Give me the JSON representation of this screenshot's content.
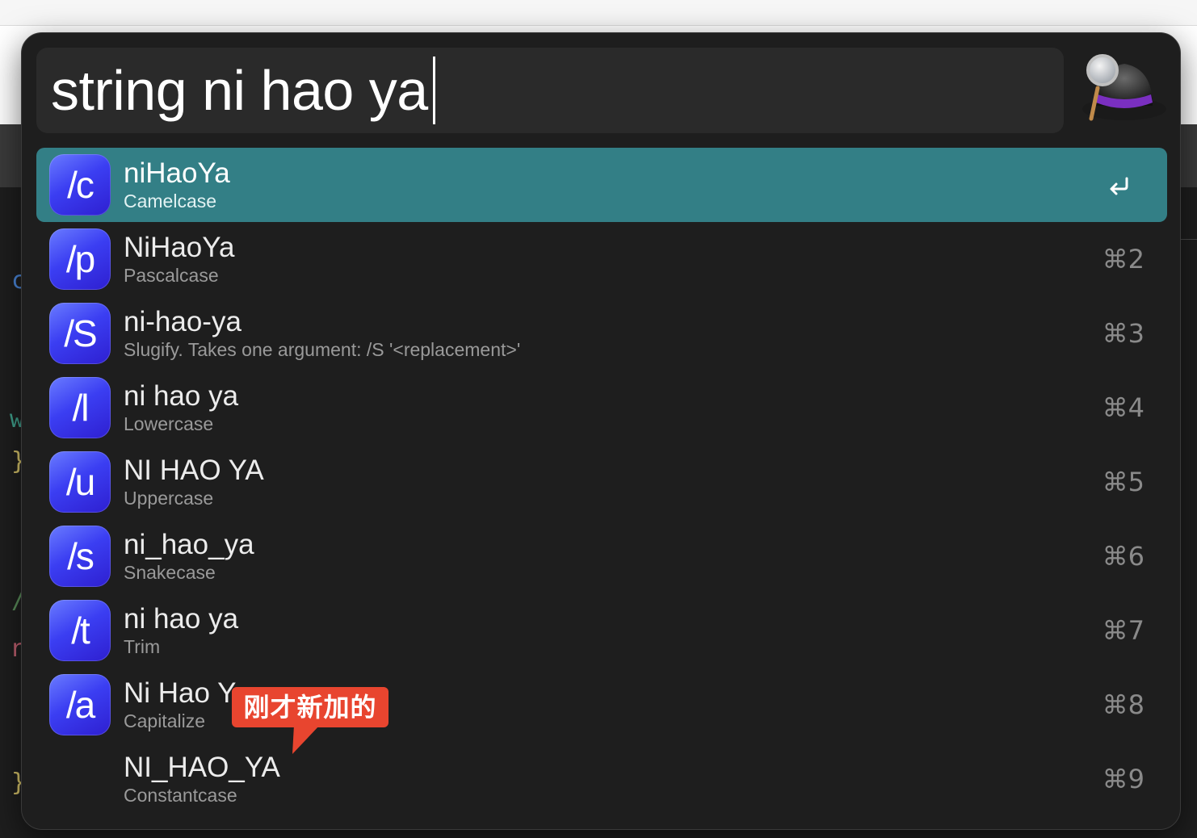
{
  "search": {
    "query": "string ni hao ya"
  },
  "results": [
    {
      "icon_text": "/c",
      "title": "niHaoYa",
      "subtitle": "Camelcase",
      "shortcut": "",
      "selected": true
    },
    {
      "icon_text": "/p",
      "title": "NiHaoYa",
      "subtitle": "Pascalcase",
      "shortcut": "⌘2"
    },
    {
      "icon_text": "/S",
      "title": "ni-hao-ya",
      "subtitle": "Slugify. Takes one argument:  /S '<replacement>'",
      "shortcut": "⌘3"
    },
    {
      "icon_text": "/l",
      "title": "ni hao ya",
      "subtitle": "Lowercase",
      "shortcut": "⌘4"
    },
    {
      "icon_text": "/u",
      "title": "NI HAO YA",
      "subtitle": "Uppercase",
      "shortcut": "⌘5"
    },
    {
      "icon_text": "/s",
      "title": "ni_hao_ya",
      "subtitle": "Snakecase",
      "shortcut": "⌘6"
    },
    {
      "icon_text": "/t",
      "title": "ni hao ya",
      "subtitle": "Trim",
      "shortcut": "⌘7"
    },
    {
      "icon_text": "/a",
      "title": "Ni Hao Y",
      "subtitle": "Capitalize",
      "shortcut": "⌘8"
    },
    {
      "icon_text": "",
      "title": "NI_HAO_YA",
      "subtitle": "Constantcase",
      "shortcut": "⌘9"
    }
  ],
  "annotation": {
    "text": "刚才新加的"
  },
  "icons": {
    "enter": "return-icon",
    "logo": "alfred-hat-icon"
  },
  "colors": {
    "selected_row": "#337f86",
    "callout": "#e8452f",
    "icon_gradient_start": "#6a7cff",
    "icon_gradient_end": "#2e1fd0"
  }
}
